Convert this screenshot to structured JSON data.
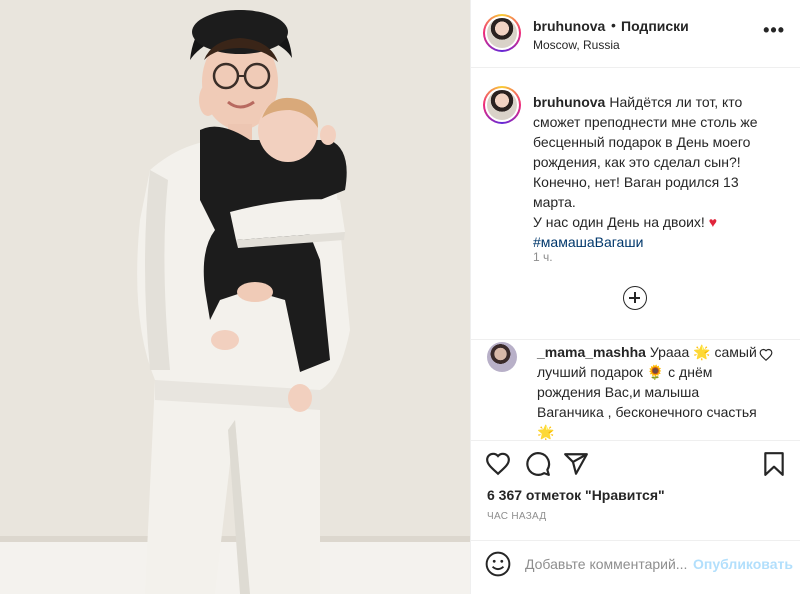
{
  "post": {
    "username": "bruhunova",
    "dot": "•",
    "follow_label": "Подписки",
    "location": "Moscow, Russia",
    "more_label": "•••"
  },
  "caption": {
    "username": "bruhunova",
    "text": "Найдётся ли тот, кто сможет преподнести мне столь же бесценный подарок в День моего рождения, как это сделал сын?! Конечно, нет! Ваган родился 13 марта.",
    "text2": "У нас один День на двоих!",
    "heart": "♥",
    "hashtag": "#мамашаВагаши",
    "time": "1 ч."
  },
  "comment": {
    "username": "_mama_mashha",
    "text_part1": "Урааа",
    "emoji1": "🌟",
    "text_part2": "самый лучший подарок",
    "emoji2": "🌻",
    "text_part3": "с днём рождения Вас,и малыша Ваганчика , бесконечного счастья",
    "emoji3": "🌟"
  },
  "actions": {
    "likes": "6 367 отметок \"Нравится\"",
    "posted_ago": "ЧАС НАЗАД"
  },
  "add_comment": {
    "placeholder": "Добавьте комментарий...",
    "publish_label": "Опубликовать"
  },
  "colors": {
    "text": "#262626",
    "secondary": "#8e8e8e",
    "link": "#00376b",
    "publish_disabled": "#b2dffc",
    "heart": "#e0243b"
  },
  "icons": [
    "more-icon",
    "plus-circle-icon",
    "heart-outline-icon",
    "comment-icon",
    "share-icon",
    "bookmark-icon",
    "emoji-icon"
  ]
}
